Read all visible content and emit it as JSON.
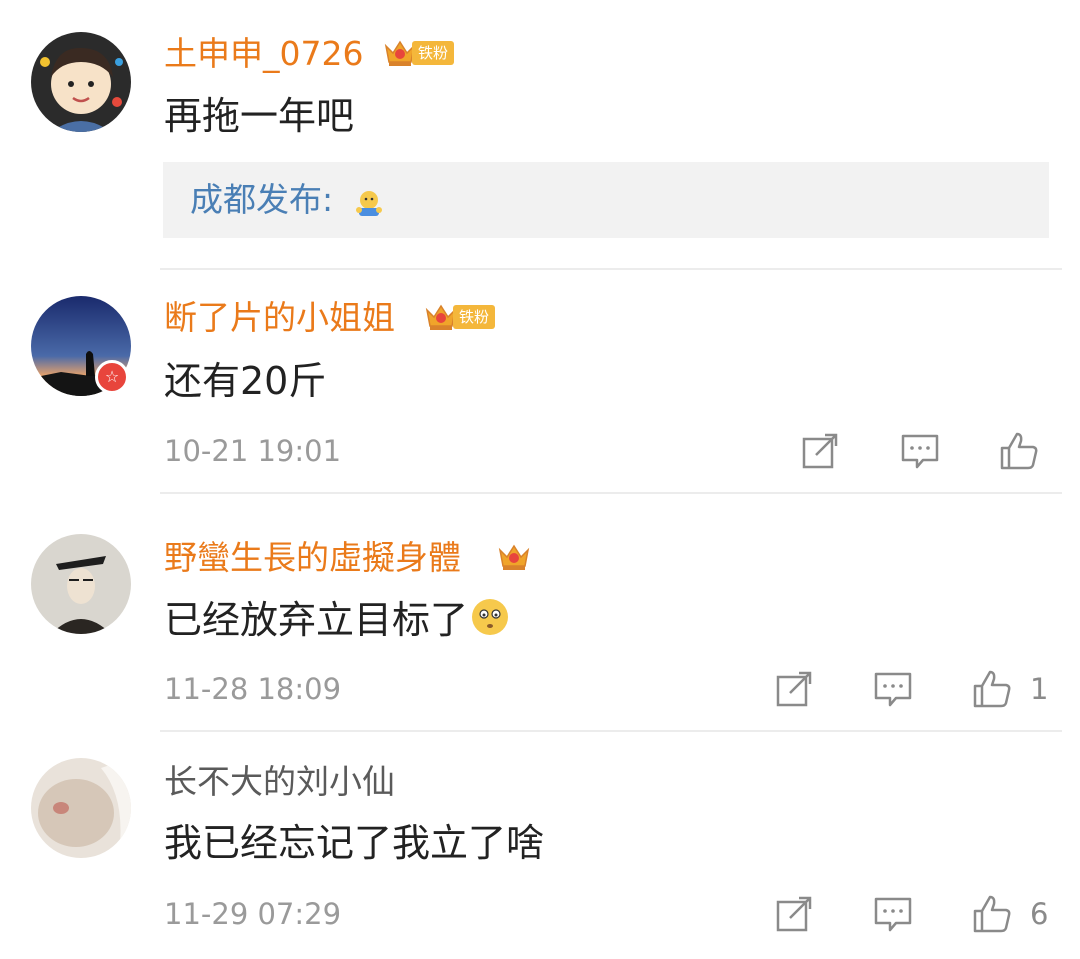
{
  "comments": [
    {
      "username": "土申申_0726",
      "fan_badge": "铁粉",
      "content": "再拖一年吧",
      "reply": {
        "name": "成都发布",
        "colon": ":"
      }
    },
    {
      "username": "断了片的小姐姐",
      "fan_badge": "铁粉",
      "content": "还有20斤",
      "time": "10-21 19:01"
    },
    {
      "username": "野蠻生長的虛擬身體",
      "content": "已经放弃立目标了",
      "time": "11-28 18:09",
      "likes": "1"
    },
    {
      "username": "长不大的刘小仙",
      "content": "我已经忘记了我立了啥",
      "time": "11-29 07:29",
      "likes": "6"
    }
  ],
  "icons": {
    "share": "share-icon",
    "comment": "comment-icon",
    "like": "like-icon",
    "crown": "crown-icon"
  },
  "colors": {
    "username_member": "#ea7a1a",
    "username_regular": "#5a5a5a",
    "reply_link": "#4a7fb5",
    "timestamp": "#9a9a9a",
    "fan_badge_bg": "#f4b73b"
  }
}
